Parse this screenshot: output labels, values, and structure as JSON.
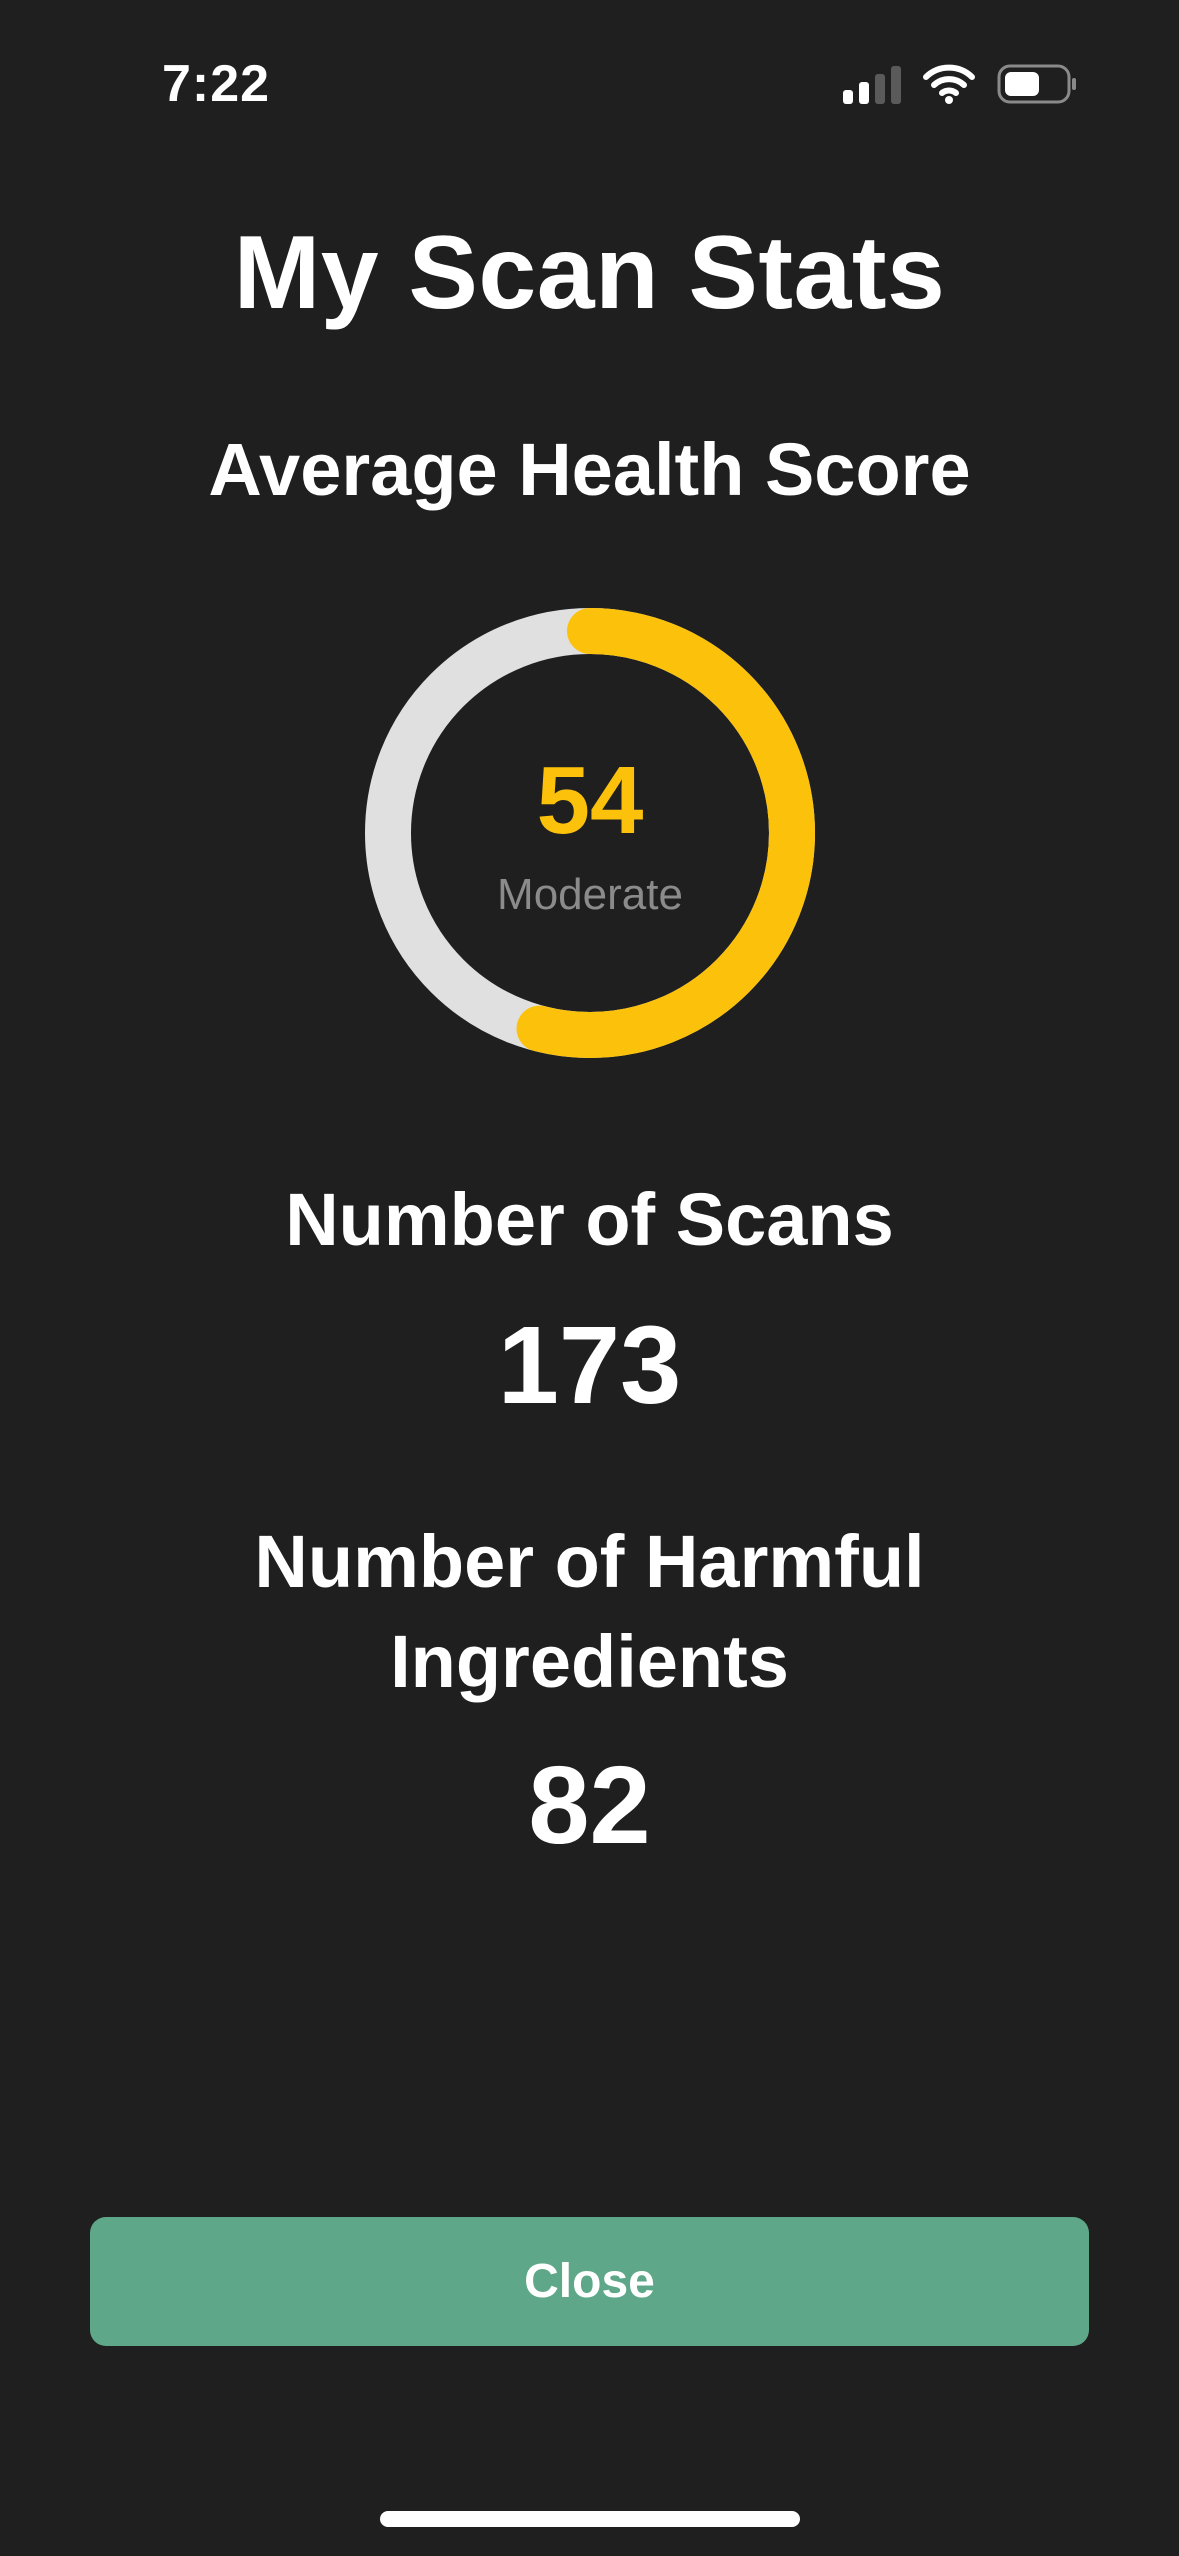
{
  "status_bar": {
    "time": "7:22",
    "icons": [
      "signal-icon",
      "wifi-icon",
      "battery-icon"
    ]
  },
  "page": {
    "title": "My Scan Stats"
  },
  "health_score": {
    "heading": "Average Health Score",
    "value": "54",
    "score_fraction": 0.54,
    "label": "Moderate",
    "ring_color": "#fcc10a",
    "track_color": "#e0e0e0"
  },
  "scans": {
    "heading": "Number of Scans",
    "value": "173"
  },
  "harmful": {
    "heading_line1": "Number of Harmful",
    "heading_line2": "Ingredients",
    "value": "82"
  },
  "actions": {
    "close_label": "Close",
    "button_color": "#5ea889"
  },
  "theme": {
    "background": "#1f1f1f",
    "text": "#ffffff",
    "muted_text": "#8b8b8b"
  }
}
